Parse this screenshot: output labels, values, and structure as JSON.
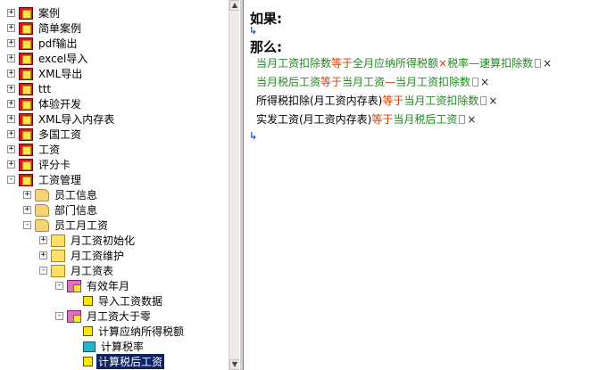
{
  "tree": {
    "items": [
      {
        "label": "案例",
        "icon": "report-icon",
        "sign": "+"
      },
      {
        "label": "简单案例",
        "icon": "report-icon",
        "sign": "+"
      },
      {
        "label": "pdf输出",
        "icon": "report-icon",
        "sign": "+"
      },
      {
        "label": "excel导入",
        "icon": "report-icon",
        "sign": "+"
      },
      {
        "label": "XML导出",
        "icon": "report-icon",
        "sign": "+"
      },
      {
        "label": "ttt",
        "icon": "report-icon",
        "sign": "+"
      },
      {
        "label": "体验开发",
        "icon": "report-icon",
        "sign": "+"
      },
      {
        "label": "XML导入内存表",
        "icon": "report-icon",
        "sign": "+"
      },
      {
        "label": "多国工资",
        "icon": "report-icon",
        "sign": "+"
      },
      {
        "label": "工资",
        "icon": "report-icon",
        "sign": "+"
      },
      {
        "label": "评分卡",
        "icon": "report-icon",
        "sign": "+"
      },
      {
        "label": "工资管理",
        "icon": "report-icon",
        "sign": "-"
      },
      {
        "label": "员工信息",
        "icon": "folder-icon",
        "sign": "+"
      },
      {
        "label": "部门信息",
        "icon": "folder-icon",
        "sign": "+"
      },
      {
        "label": "员工月工资",
        "icon": "folder-open-icon",
        "sign": "-"
      },
      {
        "label": "月工资初始化",
        "icon": "table-folder-icon",
        "sign": "+"
      },
      {
        "label": "月工资维护",
        "icon": "table-folder-icon",
        "sign": "+"
      },
      {
        "label": "月工资表",
        "icon": "table-folder-icon",
        "sign": "-"
      },
      {
        "label": "有效年月",
        "icon": "rule-set-icon",
        "sign": "-"
      },
      {
        "label": "导入工资数据",
        "icon": "calc-icon",
        "sign": ""
      },
      {
        "label": "月工资大于零",
        "icon": "rule-set-icon",
        "sign": "-"
      },
      {
        "label": "计算应纳所得税额",
        "icon": "calc-icon",
        "sign": ""
      },
      {
        "label": "计算税率",
        "icon": "table-calc-icon",
        "sign": ""
      },
      {
        "label": "计算税后工资",
        "icon": "calc-icon",
        "sign": "",
        "selected": true
      }
    ]
  },
  "rule": {
    "if_label": "如果:",
    "then_label": "那么:",
    "actions": [
      {
        "parts": [
          "当月工资扣除数",
          "等于",
          "全月应纳所得税额",
          "×",
          "税率",
          "—",
          "速算扣除数"
        ]
      },
      {
        "parts": [
          "当月税后工资",
          "等于",
          "当月工资",
          "—",
          "当月工资扣除数"
        ]
      },
      {
        "parts": [
          "所得税扣除(月工资内存表)",
          "等于",
          "当月工资扣除数"
        ]
      },
      {
        "parts": [
          "实发工资(月工资内存表)",
          "等于",
          "当月税后工资"
        ]
      }
    ],
    "delete_symbol": "×"
  }
}
